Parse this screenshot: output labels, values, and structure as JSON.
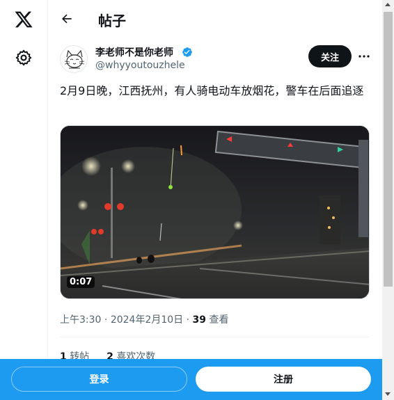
{
  "header": {
    "title": "帖子"
  },
  "post": {
    "author_name": "李老师不是你老师",
    "author_handle": "@whyyoutouzhele",
    "follow_label": "关注",
    "text": "2月9日晚，江西抚州，有人骑电动车放烟花，警车在后面追逐",
    "video_duration": "0:07",
    "time": "上午3:30",
    "date": "2024年2月10日",
    "views_count": "39",
    "views_label": "查看",
    "separator": "·",
    "reposts_count": "1",
    "reposts_label": "转帖",
    "likes_count": "2",
    "likes_label": "喜欢次数"
  },
  "bottom_bar": {
    "login_label": "登录",
    "signup_label": "注册"
  },
  "colors": {
    "accent": "#1d9bf0",
    "verified": "#1d9bf0",
    "text_primary": "#0f1419",
    "text_secondary": "#536471"
  },
  "icons": {
    "logo": "x-logo-icon",
    "settings": "gear-icon",
    "back": "back-arrow-icon",
    "verified": "verified-badge-icon",
    "more": "more-icon"
  }
}
